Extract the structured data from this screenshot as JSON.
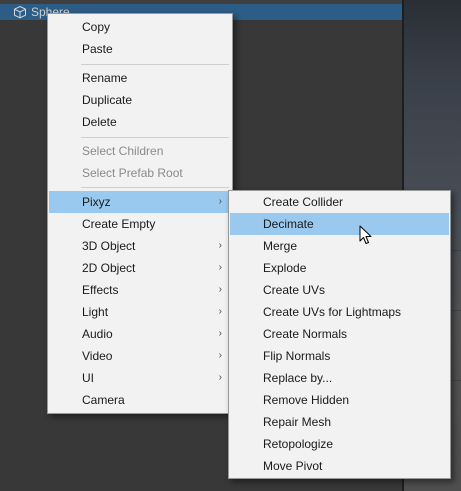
{
  "hierarchy": {
    "selected_object": "Sphere"
  },
  "context_menu": {
    "items": [
      {
        "label": "Copy"
      },
      {
        "label": "Paste"
      },
      {
        "label": "Rename"
      },
      {
        "label": "Duplicate"
      },
      {
        "label": "Delete"
      },
      {
        "label": "Select Children"
      },
      {
        "label": "Select Prefab Root"
      },
      {
        "label": "Pixyz"
      },
      {
        "label": "Create Empty"
      },
      {
        "label": "3D Object"
      },
      {
        "label": "2D Object"
      },
      {
        "label": "Effects"
      },
      {
        "label": "Light"
      },
      {
        "label": "Audio"
      },
      {
        "label": "Video"
      },
      {
        "label": "UI"
      },
      {
        "label": "Camera"
      }
    ]
  },
  "pixyz_submenu": {
    "items": [
      {
        "label": "Create Collider"
      },
      {
        "label": "Decimate"
      },
      {
        "label": "Merge"
      },
      {
        "label": "Explode"
      },
      {
        "label": "Create UVs"
      },
      {
        "label": "Create UVs for Lightmaps"
      },
      {
        "label": "Create Normals"
      },
      {
        "label": "Flip Normals"
      },
      {
        "label": "Replace by..."
      },
      {
        "label": "Remove Hidden"
      },
      {
        "label": "Repair Mesh"
      },
      {
        "label": "Retopologize"
      },
      {
        "label": "Move Pivot"
      }
    ]
  },
  "submenu_arrow": "›",
  "colors": {
    "menu_bg": "#f2f2f2",
    "highlight": "#99c9ef",
    "selection_row": "#2c5d87",
    "disabled_text": "#8b8b8b"
  }
}
